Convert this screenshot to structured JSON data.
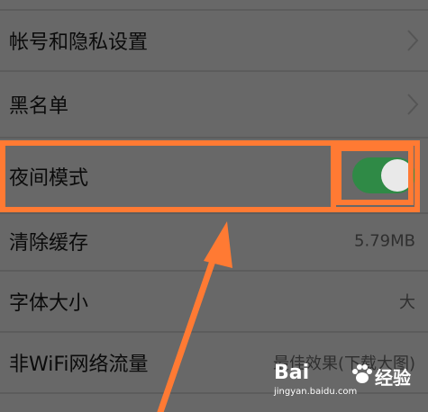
{
  "settings": {
    "items": [
      {
        "label": "帐号和隐私设置",
        "value": ""
      },
      {
        "label": "黑名单",
        "value": ""
      },
      {
        "label": "夜间模式",
        "value": ""
      },
      {
        "label": "清除缓存",
        "value": "5.79MB"
      },
      {
        "label": "字体大小",
        "value": "大"
      },
      {
        "label": "非WiFi网络流量",
        "value": "最佳效果(下载大图)"
      }
    ],
    "night_mode_on": true
  },
  "colors": {
    "background": "#686868",
    "toggle_on": "#2f8a46",
    "highlight": "#ff7a33"
  },
  "watermark": {
    "brand": "Bai",
    "jingyan": "经验",
    "url": "jingyan.baidu.com"
  }
}
